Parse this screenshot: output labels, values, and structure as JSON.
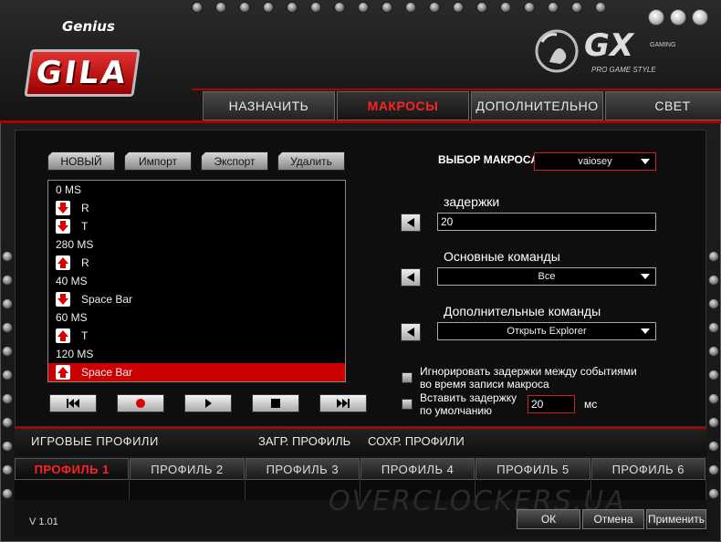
{
  "brand": {
    "genius": "Genius",
    "gila": "GILA",
    "gx": "GX",
    "gx_gaming": "GAMING",
    "gx_tagline": "PRO GAME STYLE"
  },
  "tabs": [
    {
      "label": "НАЗНАЧИТЬ",
      "active": false
    },
    {
      "label": "МАКРОСЫ",
      "active": true
    },
    {
      "label": "ДОПОЛНИТЕЛЬНО",
      "active": false
    },
    {
      "label": "СВЕТ",
      "active": false
    }
  ],
  "macro_buttons": {
    "new": "НОВЫЙ",
    "import": "Импорт",
    "export": "Экспорт",
    "delete": "Удалить"
  },
  "macro_list": [
    {
      "type": "delay",
      "text": "0 MS"
    },
    {
      "type": "down",
      "text": "R"
    },
    {
      "type": "down",
      "text": "T"
    },
    {
      "type": "delay",
      "text": "280 MS"
    },
    {
      "type": "up",
      "text": "R"
    },
    {
      "type": "delay",
      "text": "40 MS"
    },
    {
      "type": "down",
      "text": "Space Bar"
    },
    {
      "type": "delay",
      "text": "60 MS"
    },
    {
      "type": "up",
      "text": "T"
    },
    {
      "type": "delay",
      "text": "120 MS"
    },
    {
      "type": "up",
      "text": "Space Bar",
      "selected": true
    }
  ],
  "macro_select": {
    "label": "ВЫБОР МАКРОСА",
    "value": "vaiosey"
  },
  "delays": {
    "label": "задержки",
    "value": "20"
  },
  "basic_commands": {
    "label": "Основные команды",
    "value": "Все"
  },
  "extra_commands": {
    "label": "Дополнительные команды",
    "value": "Открыть Explorer"
  },
  "ignore_delays": {
    "line1": "Игнорировать задержки между событиями",
    "line2": "во время записи макроса"
  },
  "default_delay": {
    "line1": "Вставить задержку",
    "line2": "по умолчанию",
    "value": "20",
    "unit": "мс"
  },
  "profiles": {
    "title": "ИГРОВЫЕ ПРОФИЛИ",
    "load": "ЗАГР. ПРОФИЛЬ",
    "save": "СОХР. ПРОФИЛИ",
    "items": [
      "ПРОФИЛЬ 1",
      "ПРОФИЛЬ 2",
      "ПРОФИЛЬ 3",
      "ПРОФИЛЬ 4",
      "ПРОФИЛЬ 5",
      "ПРОФИЛЬ 6"
    ],
    "active_index": 0
  },
  "footer": {
    "version": "V 1.01",
    "ok": "ОК",
    "cancel": "Отмена",
    "apply": "Применить",
    "watermark": "OVERCLOCKERS.UA"
  },
  "colors": {
    "accent": "#cc0000",
    "text": "#ffffff",
    "panel": "#0e0e0e"
  }
}
